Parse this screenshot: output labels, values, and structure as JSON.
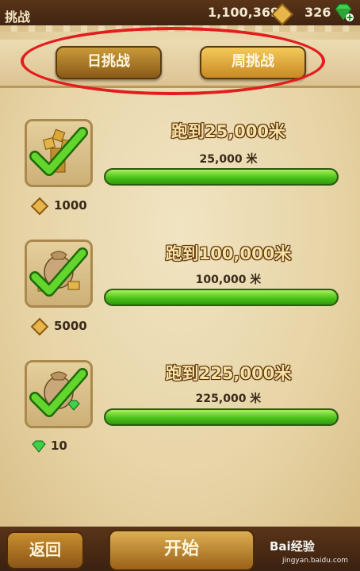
{
  "header": {
    "title": "挑战",
    "coins": "1,100,369",
    "gems": "326"
  },
  "tabs": [
    {
      "label": "日挑战",
      "active": false
    },
    {
      "label": "周挑战",
      "active": true
    }
  ],
  "challenges": [
    {
      "goal": "跑到25,000米",
      "distance": "25,000 米",
      "progress": 1.0,
      "reward": "1000",
      "reward_type": "coin"
    },
    {
      "goal": "跑到100,000米",
      "distance": "100,000 米",
      "progress": 1.0,
      "reward": "5000",
      "reward_type": "coin"
    },
    {
      "goal": "跑到225,000米",
      "distance": "225,000 米",
      "progress": 1.0,
      "reward": "10",
      "reward_type": "gem"
    }
  ],
  "footer": {
    "back_label": "返回",
    "start_label": "开始",
    "watermark": "Bai经验",
    "watermark_url": "jingyan.baidu.com"
  },
  "colors": {
    "highlight_ring": "#e21d1d",
    "progress_fill": "#4cc21a"
  }
}
